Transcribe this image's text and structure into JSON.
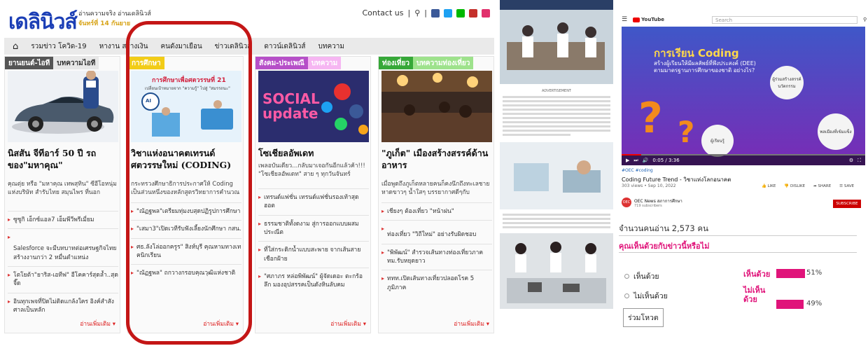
{
  "news": {
    "logo": "เดลินิวส์",
    "tagline1": "อ่านความจริง อ่านเดลินิวส์",
    "tagline2": "จันทร์ที่ 14 กันยาย",
    "contact": "Contact us",
    "nav": [
      "รวมข่าว โควิด-19",
      "หางาน สร้างเงิน",
      "คนดังมาเยือน",
      "ข่าวเดลินิวส์",
      "ดาวน์เดลินิวส์",
      "บทความ"
    ],
    "columns": [
      {
        "tabs": [
          "ยานยนต์-ไอที",
          "บทความไอที"
        ],
        "tab_colors": [
          "#555555",
          "#e8e8e8"
        ],
        "headline": "นิสสัน จีทีอาร์ 50 ปี รถของ\"มหาคุณ\"",
        "desc": "คุณตุ่ย หรือ \"มหาคุณ เทพสุทิน\" ซีอีโอหนุ่มแห่งบริษัท สำรับไทย สมุนไพร ที่นอก",
        "items": [
          "ซูซูกิ เอ็กซ์แอล7 เอ็มพีวีพรีเมี่ยม",
          "Salesforce จะมีบทบาทต่อเศรษฐกิจไทย สร้างงานกว่า 2 หมื่นตำแหน่ง",
          "โตโยต้า\"ยาริส-เอทีฟ\" อีโคคาร์สุดล้ำ..สุดจี๊ด",
          "อินทุกเพจที่ปิดไม่ติดแกล้งใคร อิงค์สำสังศาลเป็นหลัก"
        ],
        "more": "อ่านเพิ่มเติม ▾"
      },
      {
        "tabs": [
          "การศึกษา"
        ],
        "tab_colors": [
          "#f2cc17"
        ],
        "hero_title": "การศึกษาเพื่อศตวรรษที่ 21",
        "hero_sub": "เปลี่ยนเป้าหมายจาก \"ความรู้\" ไปสู่ \"สมรรถนะ\"",
        "headline": "วิชาแห่งอนาคตเทรนด์ศตวรรษใหม่ (CODING)",
        "desc": "กระทรวงศึกษาธิการประกาศให้ Coding เป็นส่วนหนึ่งของหลักสูตรวิทยาการคำนวณ",
        "items": [
          "\"ณัฏฐพล\"เตรียมทุ่มงบสุดปฏิรูปการศึกษา",
          "\"เสมา3\"เปิดเวทีรับฟังเลี้ยงนักศึกษา กสน.",
          "ศธ.ลังโล่ออกครูร\" สิงห์บุรี คุณหามทางเทคนิกเรียน",
          "\"ณัฏฐพล\" ถกวางกรอบคุณวุฒิแห่งชาติ"
        ],
        "more": "อ่านเพิ่มเติม ▾"
      },
      {
        "tabs": [
          "สังคม-ประเพณี",
          "บทความ"
        ],
        "tab_colors": [
          "#b64fc8",
          "#f6b6f2"
        ],
        "hero_title": "SOCIAL update",
        "headline": "โซเชียลอัพเดท",
        "desc": "เพลอบันเดียว...กลับมาเจอกันอีกแล้วค้า!!! \"โซเชียลอัพเดท\" สาย ๆ ทุกวันจันทร์",
        "items": [
          "เทรนด์แฟชั่น เทรนด์แฟชั่นรองเท้าสุดฮอต",
          "ธรรมชาติทั้งดงาม สู่การออกแบบผสมประณีต",
          "ที่ใส่กระดิกน้ำแบบสะพาย จากเส้นสายเชือกฝ้าย",
          "\"ศภาภร หล่อพิพัฒน์\" ผู้จัดเดอะ ตะกร้อลึก มองอุปสรรคเป็นดังหินลับคม"
        ],
        "more": "อ่านเพิ่มเติม ▾"
      },
      {
        "tabs": [
          "ท่องเที่ยว",
          "บทความท่องเที่ยว"
        ],
        "tab_colors": [
          "#36a838",
          "#9ee28c"
        ],
        "headline": "\"ภูเก็ต\" เมืองสร้างสรรค์ด้านอาหาร",
        "desc": "เมื่อพูดถึงภูเก็ตหลายคนก็คงนึกถึงทะเลชายหาดขาวๆ น้ำใสๆ บรรยากาศดีๆกับ",
        "items": [
          "เชียงๆ ต้องเที่ยว \"หน้าฝน\"",
          "ท่องเที่ยว \"วิถีใหม่\" อย่างรับผิดชอบ",
          "\"พิพัฒน์\" สำรวจเส้นทางท่องเที่ยวภาค ทม.รับหยุดยาว",
          "ททท.เปิดเส้นทางเที่ยวปลอดโรค 5 ภูมิภาค"
        ],
        "more": "อ่านเพิ่มเติม ▾"
      }
    ]
  },
  "article": {
    "advert": "ADVERTISEMENT"
  },
  "video": {
    "search_placeholder": "Search",
    "yt_label": "YouTube",
    "slide_title": "การเรียน Coding",
    "slide_sub": "สร้างผู้เรียนให้มีผลลัพธ์ที่พึงประสงค์ (DEE) ตามมาตรฐานการศึกษาของชาติ อย่างไร?",
    "bubble_learner": "ผู้เรียนรู้",
    "bubble_innovator": "ผู้ร่วมสร้างสรรค์นวัตกรรม",
    "bubble_citizen": "พลเมืองที่เข้มแข็ง",
    "time": "0:05 / 3:36",
    "title": "Coding Future Trend - วิชาแห่งโลกอนาคต",
    "meta": "303 views • Sep 10, 2022",
    "actions": [
      "LIKE",
      "DISLIKE",
      "SHARE",
      "SAVE"
    ],
    "channel": "OEC News สภาการศึกษา",
    "subs": "719 subscribers",
    "subscribe": "SUBSCRIBE"
  },
  "poll": {
    "readers": "จำนวนคนอ่าน 2,573 คน",
    "question": "คุณเห็นด้วยกับข่าวนี้หรือไม่",
    "options": [
      "เห็นด้วย",
      "ไม่เห็นด้วย"
    ],
    "results": [
      {
        "label": "เห็นด้วย",
        "percent": "51%",
        "value": 51
      },
      {
        "label": "ไม่เห็นด้วย",
        "percent": "49%",
        "value": 49
      }
    ],
    "vote": "ร่วมโหวต",
    "accent": "#e0147a"
  }
}
